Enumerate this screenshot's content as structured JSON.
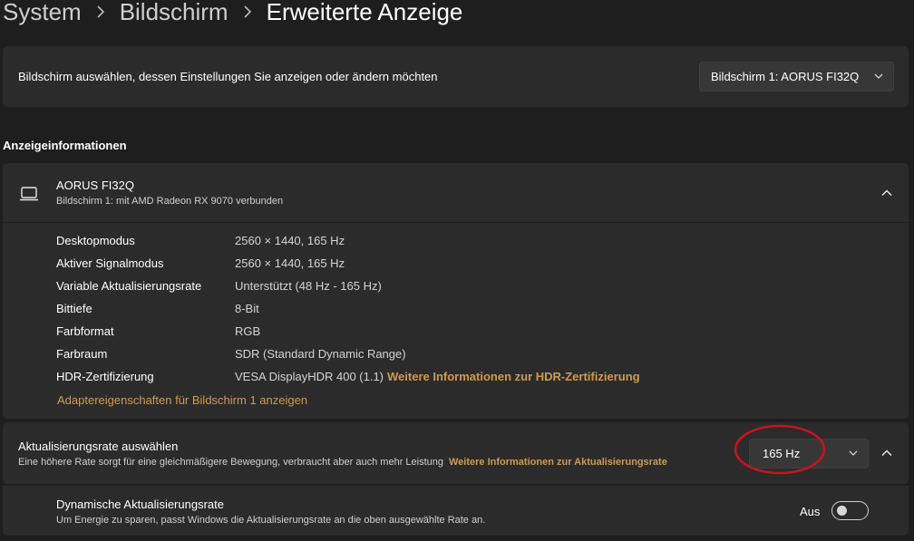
{
  "breadcrumb": {
    "items": [
      "System",
      "Bildschirm"
    ],
    "current": "Erweiterte Anzeige"
  },
  "select_display": {
    "label": "Bildschirm auswählen, dessen Einstellungen Sie anzeigen oder ändern möchten",
    "selected": "Bildschirm 1: AORUS FI32Q"
  },
  "display_info": {
    "section_title": "Anzeigeinformationen",
    "monitor_name": "AORUS FI32Q",
    "monitor_sub": "Bildschirm 1: mit AMD Radeon RX 9070 verbunden",
    "rows": [
      {
        "key": "Desktopmodus",
        "value": "2560 × 1440, 165 Hz"
      },
      {
        "key": "Aktiver Signalmodus",
        "value": "2560 × 1440, 165 Hz"
      },
      {
        "key": "Variable Aktualisierungsrate",
        "value": "Unterstützt (48 Hz - 165 Hz)"
      },
      {
        "key": "Bittiefe",
        "value": "8-Bit"
      },
      {
        "key": "Farbformat",
        "value": "RGB"
      },
      {
        "key": "Farbraum",
        "value": "SDR (Standard Dynamic Range)"
      },
      {
        "key": "HDR-Zertifizierung",
        "value": "VESA DisplayHDR 400 (1.1)",
        "link": "Weitere Informationen zur HDR-Zertifizierung"
      }
    ],
    "adapter_link": "Adaptereigenschaften für Bildschirm 1 anzeigen"
  },
  "refresh_rate": {
    "title": "Aktualisierungsrate auswählen",
    "subtitle": "Eine höhere Rate sorgt für eine gleichmäßigere Bewegung, verbraucht aber auch mehr Leistung",
    "link": "Weitere Informationen zur Aktualisierungsrate",
    "selected": "165 Hz"
  },
  "dynamic_rate": {
    "title": "Dynamische Aktualisierungsrate",
    "subtitle": "Um Energie zu sparen, passt Windows die Aktualisierungsrate an die oben ausgewählte Rate an.",
    "toggle_label": "Aus",
    "toggle_on": false
  },
  "colors": {
    "background": "#1e1e1e",
    "card": "#2b2b2b",
    "link": "#d19a4f",
    "annotation": "#c8141e"
  },
  "icons": [
    "chevron-right-icon",
    "chevron-down-icon",
    "chevron-up-icon",
    "monitor-icon"
  ]
}
